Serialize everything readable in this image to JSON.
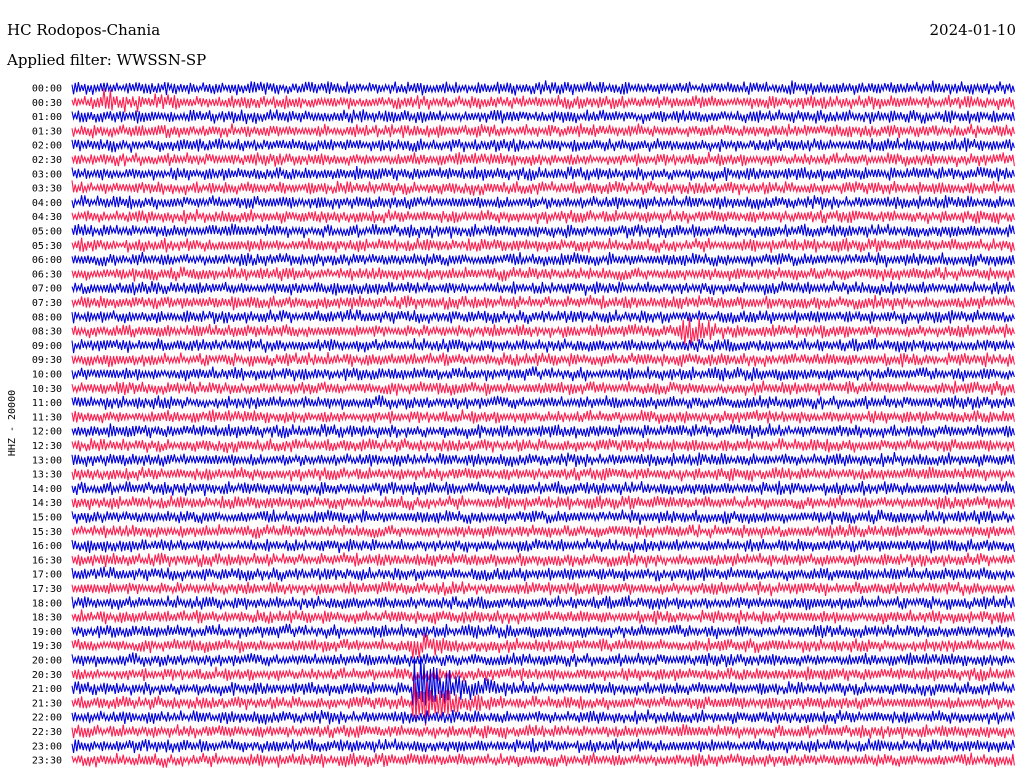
{
  "header": {
    "station": "HC Rodopos-Chania",
    "date": "2024-01-10",
    "filter": "Applied filter: WWSSN-SP"
  },
  "chart_data": {
    "type": "line",
    "title": "",
    "ylabel": "HHZ - 20000",
    "row_labels": [
      "00:00",
      "00:30",
      "01:00",
      "01:30",
      "02:00",
      "02:30",
      "03:00",
      "03:30",
      "04:00",
      "04:30",
      "05:00",
      "05:30",
      "06:00",
      "06:30",
      "07:00",
      "07:30",
      "08:00",
      "08:30",
      "09:00",
      "09:30",
      "10:00",
      "10:30",
      "11:00",
      "11:30",
      "12:00",
      "12:30",
      "13:00",
      "13:30",
      "14:00",
      "14:30",
      "15:00",
      "15:30",
      "16:00",
      "16:30",
      "17:00",
      "17:30",
      "18:00",
      "18:30",
      "19:00",
      "19:30",
      "20:00",
      "20:30",
      "21:00",
      "21:30",
      "22:00",
      "22:30",
      "23:00",
      "23:30"
    ],
    "colors": [
      "#0000dd",
      "#ff1f4f"
    ],
    "events": [
      {
        "row": "00:30",
        "offset_fraction": 0.04,
        "amplitude_scale": 2.0
      },
      {
        "row": "08:30",
        "offset_fraction": 0.65,
        "amplitude_scale": 2.2
      },
      {
        "row": "19:30",
        "offset_fraction": 0.37,
        "amplitude_scale": 2.0
      },
      {
        "row": "21:00",
        "offset_fraction": 0.37,
        "amplitude_scale": 5.0
      },
      {
        "row": "21:30",
        "offset_fraction": 0.37,
        "amplitude_scale": 4.0
      }
    ]
  }
}
